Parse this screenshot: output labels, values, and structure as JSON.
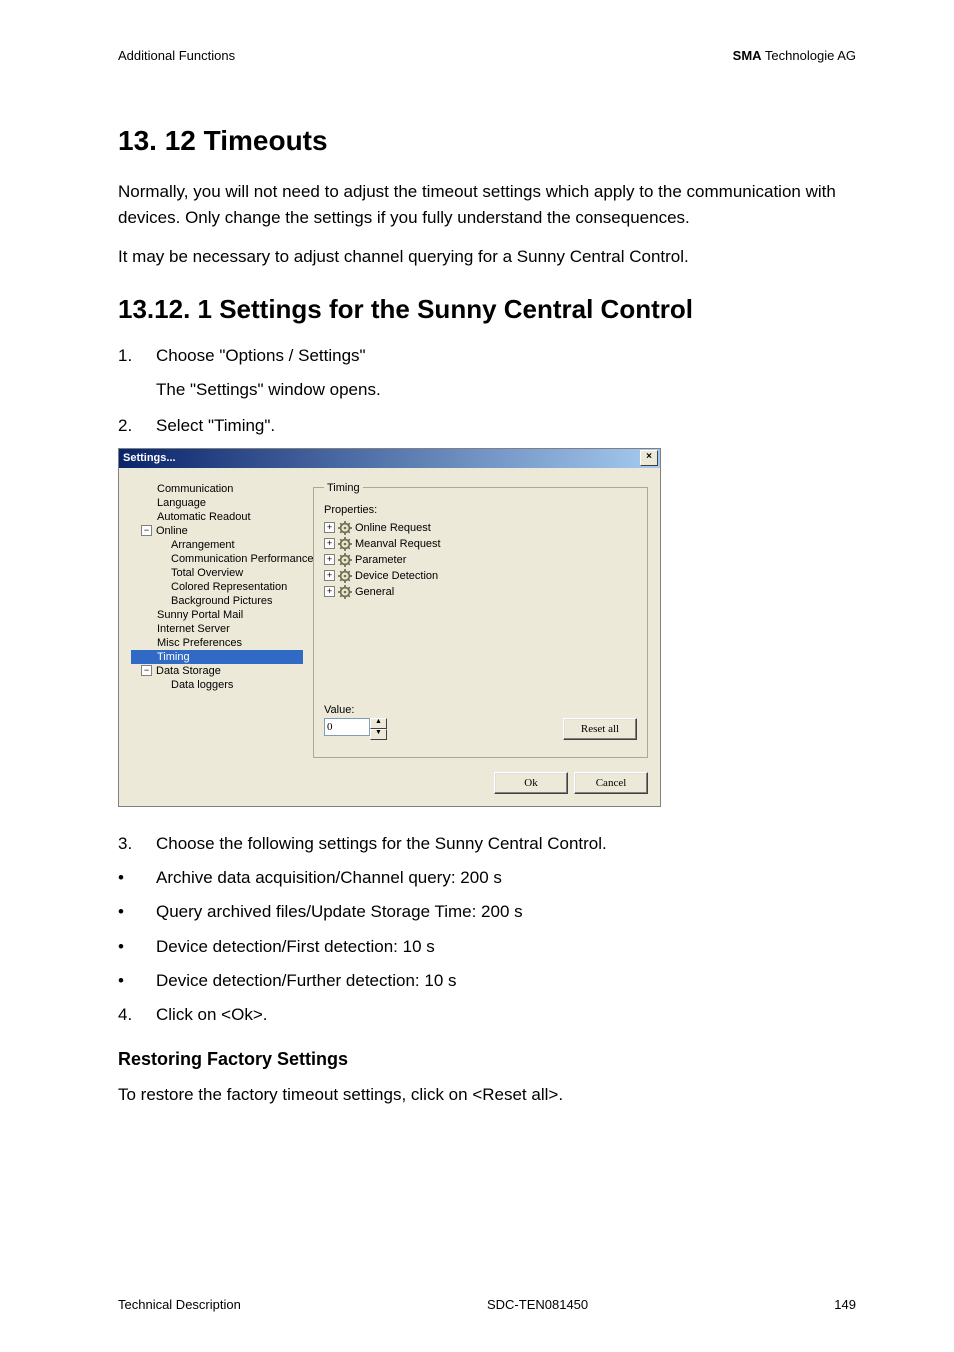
{
  "header": {
    "left": "Additional Functions",
    "right_bold": "SMA",
    "right_rest": " Technologie AG"
  },
  "section_title": "13. 12 Timeouts",
  "para1": "Normally, you will not need to adjust the timeout settings which apply to the communication with devices. Only change the settings if you fully understand the consequences.",
  "para2": "It may be necessary to adjust channel querying for a Sunny Central Control.",
  "subsection_title": "13.12. 1 Settings for the Sunny Central Control",
  "step1_n": "1.",
  "step1": "Choose \"Options / Settings\"",
  "step1_sub": "The \"Settings\" window opens.",
  "step2_n": "2.",
  "step2": "Select \"Timing\".",
  "step3_n": "3.",
  "step3": "Choose the following settings for the Sunny Central Control.",
  "bullets": [
    "Archive data acquisition/Channel query: 200 s",
    "Query archived files/Update Storage Time: 200 s",
    "Device detection/First detection: 10 s",
    "Device detection/Further detection: 10 s"
  ],
  "step4_n": "4.",
  "step4": "Click on <Ok>.",
  "minor_heading": "Restoring Factory Settings",
  "para3": "To restore the factory timeout settings, click on <Reset all>.",
  "footer": {
    "left": "Technical Description",
    "center": "SDC-TEN081450",
    "right": "149"
  },
  "dialog": {
    "title": "Settings...",
    "close": "×",
    "nav": {
      "items": [
        {
          "label": "Communication",
          "cls": "ind1"
        },
        {
          "label": "Language",
          "cls": "ind1"
        },
        {
          "label": "Automatic Readout",
          "cls": "ind1"
        },
        {
          "label": "Online",
          "tree": true,
          "sign": "−"
        },
        {
          "label": "Arrangement",
          "cls": "ind2"
        },
        {
          "label": "Communication Performance",
          "cls": "ind2"
        },
        {
          "label": "Total Overview",
          "cls": "ind2"
        },
        {
          "label": "Colored Representation",
          "cls": "ind2"
        },
        {
          "label": "Background Pictures",
          "cls": "ind2"
        },
        {
          "label": "Sunny Portal Mail",
          "cls": "ind1"
        },
        {
          "label": "Internet Server",
          "cls": "ind1"
        },
        {
          "label": "Misc Preferences",
          "cls": "ind1"
        },
        {
          "label": "Timing",
          "cls": "ind1 sel"
        },
        {
          "label": "Data Storage",
          "tree": true,
          "sign": "−"
        },
        {
          "label": "Data loggers",
          "cls": "ind2"
        }
      ]
    },
    "timing_legend": "Timing",
    "properties_label": "Properties:",
    "properties": [
      "Online Request",
      "Meanval Request",
      "Parameter",
      "Device Detection",
      "General"
    ],
    "value_label": "Value:",
    "value": "0",
    "reset_all": "Reset all",
    "ok": "Ok",
    "cancel": "Cancel"
  }
}
